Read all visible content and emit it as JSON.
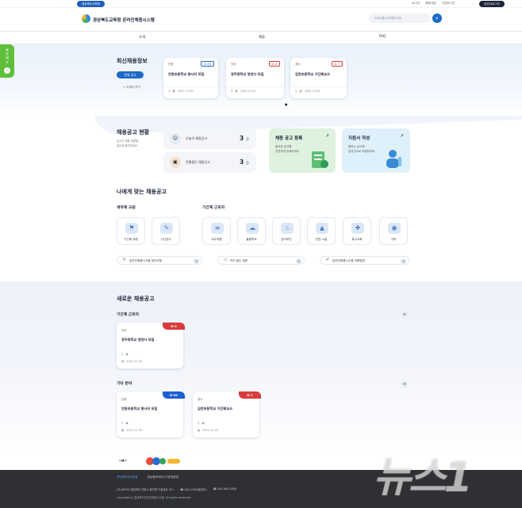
{
  "topbar": {
    "org_pill": "경상북도교육청",
    "links": [
      "로그인",
      "회원가입",
      "기관로그인"
    ],
    "login_button": "담당자로그인"
  },
  "header": {
    "logo_text": "경상북도교육청 온라인채용시스템",
    "search_placeholder": "검색어를 입력해주세요",
    "search_button": "⌕"
  },
  "nav": {
    "items": [
      "소개",
      "채용",
      "FAQ"
    ]
  },
  "side_tab": {
    "label": "빠른메뉴",
    "arrow": "→"
  },
  "latest": {
    "title": "최신채용정보",
    "all_button": "전체 공고",
    "more_link": "+ 자세히 보기",
    "cards": [
      {
        "region": "안동",
        "badge": "D-55",
        "title": "안동초등학교 봉사자 모집",
        "date": "2025-12-05",
        "tone": "blue"
      },
      {
        "region": "의성",
        "badge": "D-3",
        "title": "경주중학교 영양사 모집",
        "date": "2025-12-05",
        "tone": "red"
      },
      {
        "region": "경주",
        "badge": "D-7",
        "title": "김천초등학교 기간제교사",
        "date": "2025-12-05",
        "tone": "red"
      }
    ],
    "page_dot": "●"
  },
  "status": {
    "title": "채용공고 현황",
    "desc_1": "실시간 채용 현황을",
    "desc_2": "한눈에 확인하세요.",
    "today_label": "오늘의 채용공고",
    "today_num": "3",
    "today_unit": "건",
    "ongoing_label": "진행중인 채용공고",
    "ongoing_num": "3",
    "ongoing_unit": "건"
  },
  "features": [
    {
      "title": "채용 공고 등록",
      "desc_1": "필요한 공고를",
      "desc_2": "간편하게 등록하세요",
      "bg": "#def2df",
      "arrow": "↗"
    },
    {
      "title": "지원서 작성",
      "desc_1": "원하는 공고에",
      "desc_2": "온라인으로 지원하세요",
      "bg": "#def0f9",
      "arrow": "↗"
    }
  ],
  "match": {
    "title": "나에게 맞는 채용공고",
    "contract": {
      "label": "계약제 교원",
      "items": [
        {
          "icon": "⚑",
          "label": "기간제 교원"
        },
        {
          "icon": "✎",
          "label": "시간강사"
        }
      ]
    },
    "term": {
      "label": "기간제 근로자",
      "items": [
        {
          "icon": "≡",
          "label": "교무지원"
        },
        {
          "icon": "☁",
          "label": "돌봄학교"
        },
        {
          "icon": "♨",
          "label": "급식보건"
        },
        {
          "icon": "▲",
          "label": "안전·시설"
        },
        {
          "icon": "✚",
          "label": "특수교육"
        },
        {
          "icon": "◉",
          "label": "기타"
        }
      ]
    },
    "info": [
      {
        "icon": "⚲",
        "label": "온라인채용시스템 공지사항",
        "go": "→"
      },
      {
        "icon": "▭",
        "label": "자주 묻는 질문",
        "go": "→"
      },
      {
        "icon": "✐",
        "label": "온라인채용시스템 이용방법",
        "go": "→"
      }
    ]
  },
  "new_jobs": {
    "title": "새로운 채용공고",
    "groups": [
      {
        "label": "기간제 근로자",
        "plus": "+",
        "cards": [
          {
            "region": "의성",
            "badge": "D-3",
            "title": "경주중학교 영양사 모집",
            "date": "2025-12-05",
            "color": "#d93b3b"
          }
        ]
      },
      {
        "label": "기타 분야",
        "plus": "+",
        "cards": [
          {
            "region": "안동",
            "badge": "D-55",
            "title": "안동초등학교 봉사자 모집",
            "date": "2025-12-05",
            "color": "#1c5fd1"
          },
          {
            "region": "경주",
            "badge": "D-7",
            "title": "김천초등학교 기간제교사",
            "date": "2025-12-05",
            "color": "#d93b3b"
          }
        ]
      }
    ]
  },
  "pager": {
    "text": "◂ ▮▮ ▸"
  },
  "footer": {
    "links": [
      "개인정보처리방침",
      "영상정보처리기기운영방침"
    ],
    "addr": [
      "(우)36759 경상북도 안동시 풍천면 도청대로 511",
      "☎ 054-1396(콜센터)",
      "☎ 054-805-3849"
    ],
    "copy": "Copyright(c) 경상북도온라인채용시스템. All rights reserved."
  },
  "watermark": "뉴스1"
}
